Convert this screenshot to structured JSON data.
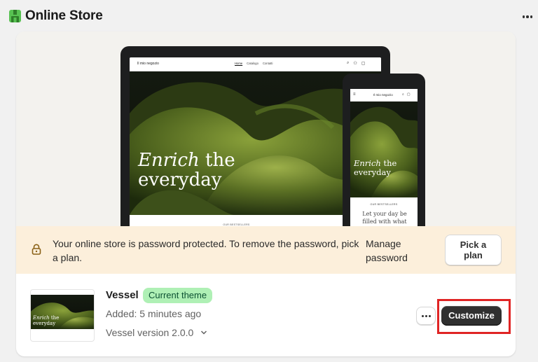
{
  "header": {
    "title": "Online Store",
    "logo_icon": "shopify-store-icon",
    "more_icon": "more-horizontal-icon"
  },
  "preview": {
    "laptop": {
      "brand": "Il mio negozio",
      "nav_links": [
        "Home",
        "Catalogo",
        "Contatti"
      ],
      "headline_italic": "Enrich",
      "headline_rest": " the",
      "headline_line2": "everyday",
      "section_label": "OUR BESTSELLERS"
    },
    "phone": {
      "brand": "Il mio negozio",
      "headline_italic": "Enrich",
      "headline_rest": " the",
      "headline_line2": "everyday",
      "section_label": "OUR BESTSELLERS",
      "tagline": "Let your day be filled with what"
    }
  },
  "banner": {
    "message": "Your online store is password protected. To remove the password, pick a plan.",
    "manage_label_1": "Manage",
    "manage_label_2": "password",
    "pick_plan_1": "Pick a",
    "pick_plan_2": "plan",
    "bg_color": "#fcefdb"
  },
  "theme": {
    "name": "Vessel",
    "badge": "Current theme",
    "added": "Added: 5 minutes ago",
    "version": "Vessel version 2.0.0",
    "thumb_headline_italic": "Enrich",
    "thumb_headline_rest": " the",
    "thumb_headline_line2": "everyday",
    "customize_label": "Customize",
    "badge_color": "#aff0b5",
    "highlight_color": "#e02424"
  }
}
